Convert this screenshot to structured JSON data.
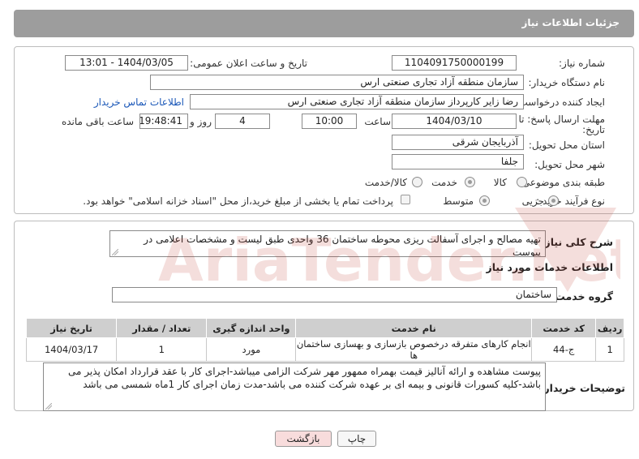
{
  "header": {
    "title": "جزئیات اطلاعات نیاز"
  },
  "form": {
    "need_number_label": "شماره نیاز:",
    "need_number": "1104091750000199",
    "announce_label": "تاریخ و ساعت اعلان عمومی:",
    "announce_value": "1404/03/05 - 13:01",
    "buyer_org_label": "نام دستگاه خریدار:",
    "buyer_org": "سازمان منطقه آزاد تجاری صنعتی ارس",
    "creator_label": "ایجاد کننده درخواست:",
    "creator": "رضا زایر کارپرداز سازمان منطقه آزاد تجاری صنعتی ارس",
    "contact_link": "اطلاعات تماس خریدار",
    "deadline_label_1": "مهلت ارسال پاسخ: تا",
    "deadline_label_2": "تاریخ:",
    "deadline_date": "1404/03/10",
    "time_label": "ساعت",
    "deadline_time": "10:00",
    "days_value": "4",
    "days_label": "روز و",
    "remaining_time": "19:48:41",
    "remaining_label": "ساعت باقی مانده",
    "province_label": "استان محل تحویل:",
    "province": "آذربایجان شرقی",
    "city_label": "شهر محل تحویل:",
    "city": "جلفا",
    "category_label": "طبقه بندی موضوعی:",
    "category_options": [
      "کالا",
      "خدمت",
      "کالا/خدمت"
    ],
    "category_selected": 1,
    "process_label": "نوع فرآیند خرید :",
    "process_options": [
      "جزیی",
      "متوسط"
    ],
    "process_selected": 0,
    "payment_note": "پرداخت تمام یا بخشی از مبلغ خرید،از محل \"اسناد خزانه اسلامی\" خواهد بود."
  },
  "description": {
    "label": "شرح کلی نیاز:",
    "text": "تهیه مصالح و اجرای آسفالت ریزی محوطه ساختمان 36 واحدی طبق لیست و مشخصات اعلامی در پیوست"
  },
  "services": {
    "section_title": "اطلاعات خدمات مورد نیاز",
    "group_label": "گروه خدمت:",
    "group_value": "ساختمان",
    "columns": [
      "ردیف",
      "کد خدمت",
      "نام خدمت",
      "واحد اندازه گیری",
      "تعداد / مقدار",
      "تاریخ نیاز"
    ],
    "rows": [
      {
        "index": "1",
        "code": "ج-44",
        "name": "انجام کارهای متفرقه درخصوص بازسازی و بهسازی ساختمان ها",
        "unit": "مورد",
        "qty": "1",
        "date": "1404/03/17"
      }
    ]
  },
  "buyer_notes": {
    "label": "توضیحات خریدار:",
    "text": "پیوست مشاهده و ارائه آنالیز قیمت بهمراه ممهور مهر شرکت الزامی میباشد-اجرای کار با عقد قرارداد امکان پذیر می باشد-کلیه کسورات قانونی و بیمه ای بر عهده شرکت کننده می باشد-مدت زمان اجرای کار 1ماه شمسی می باشد"
  },
  "buttons": {
    "print": "چاپ",
    "back": "بازگشت"
  },
  "watermark": {
    "text": "AriaTender.net"
  }
}
